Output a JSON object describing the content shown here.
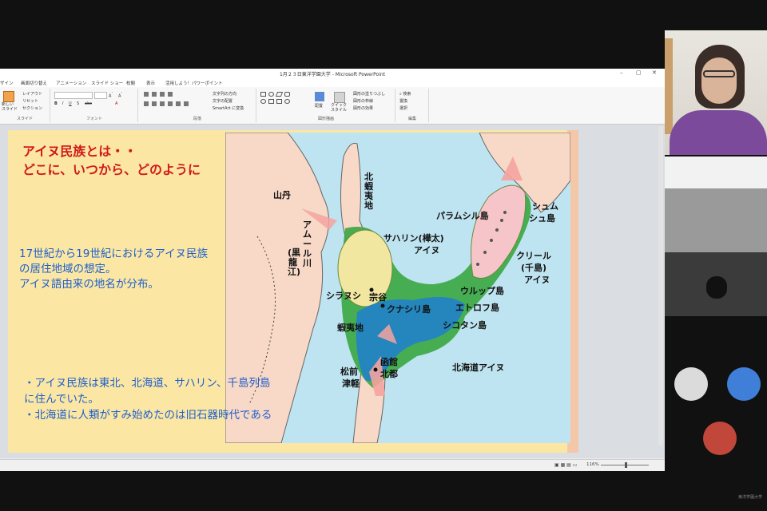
{
  "window": {
    "title": "1月２３日東洋学園大学 - Microsoft PowerPoint",
    "controls": [
      "–",
      "▢",
      "✕"
    ]
  },
  "menu": [
    "ザイン",
    "画面切り替え",
    "アニメーション",
    "スライド ショー",
    "校閲",
    "表示",
    "活用しよう！パワーポイント"
  ],
  "ribbon": {
    "slides_group": {
      "new_slide": "新しい\nスライド",
      "layout": "レイアウト",
      "reset": "リセット",
      "section": "セクション",
      "label": "スライド"
    },
    "font_group": {
      "label": "フォント"
    },
    "paragraph_group": {
      "text_direction": "文字列の方向",
      "align_text": "文字の配置",
      "smartart": "SmartArt に変換",
      "label": "段落"
    },
    "drawing_group": {
      "arrange": "配置",
      "quick_styles": "クイック\nスタイル",
      "shape_fill": "図形の塗りつぶし",
      "shape_outline": "図形の枠線",
      "shape_effects": "図形の効果",
      "label": "図形描画"
    },
    "editing_group": {
      "find": "検索",
      "replace": "置換",
      "select": "選択",
      "label": "編集"
    }
  },
  "slide": {
    "title_line1": "アイヌ民族とは・・",
    "title_line2": "どこに、いつから、どのように",
    "desc_line1": "17世紀から19世紀におけるアイヌ民族",
    "desc_line2": "の居住地域の想定。",
    "desc_line3": "アイヌ語由来の地名が分布。",
    "bullet1_line1": "・アイヌ民族は東北、北海道、サハリン、千島列島",
    "bullet1_line2": "に住んでいた。",
    "bullet2": "・北海道に人類がすみ始めたのは旧石器時代である"
  },
  "map": {
    "labels": {
      "santan": "山丹",
      "amur": "アムール川",
      "kokuryuko": "(黒龍江)",
      "kitaezochi": "北蝦夷地",
      "sakhalin_ainu_1": "サハリン(樺太)",
      "sakhalin_ainu_2": "アイヌ",
      "paramushir": "パラムシル島",
      "shumshu_1": "シュム",
      "shumshu_2": "シュ島",
      "kuril_ainu_1": "クリール",
      "kuril_ainu_2": "(千島)",
      "kuril_ainu_3": "アイヌ",
      "shiranushi": "シラヌシ",
      "soya": "宗谷",
      "kunashiri": "クナシリ島",
      "urup": "ウルップ島",
      "etorofu": "エトロフ島",
      "shikotan": "シコタン島",
      "ezochi": "蝦夷地",
      "hakodate": "函館",
      "hokuto": "北都",
      "matsumae": "松前",
      "tsugaru": "津軽",
      "hokkaido_ainu": "北海道アイヌ"
    }
  },
  "statusbar": {
    "zoom": "116%"
  },
  "footer_label": "東洋学園大学"
}
